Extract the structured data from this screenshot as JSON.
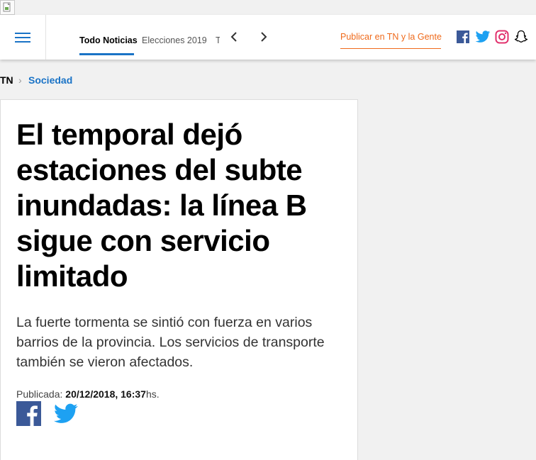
{
  "header": {
    "tabs": [
      {
        "label": "Todo Noticias",
        "active": true
      },
      {
        "label": "Elecciones 2019",
        "active": false
      },
      {
        "label": "T",
        "active": false
      }
    ],
    "publish_label": "Publicar en TN y la Gente",
    "social_icons": [
      "facebook-icon",
      "twitter-icon",
      "instagram-icon",
      "snapchat-icon"
    ]
  },
  "breadcrumb": {
    "root": "TN",
    "separator": "›",
    "section": "Sociedad"
  },
  "article": {
    "title": "El temporal dejó estaciones del subte inundadas: la línea B sigue con servicio limitado",
    "summary": "La fuerte tormenta se sintió con fuerza en varios barrios de la provincia. Los servicios de transporte también se vieron afectados.",
    "published_label": "Publicada: ",
    "published_value": "20/12/2018, 16:37",
    "published_suffix": "hs.",
    "share_icons": [
      "facebook-icon",
      "twitter-icon"
    ]
  },
  "colors": {
    "accent_blue": "#1a73c6",
    "publish_orange": "#ef6a1b",
    "facebook_blue": "#3b5998",
    "twitter_blue": "#1da1f2",
    "instagram_pink": "#e1306c"
  }
}
